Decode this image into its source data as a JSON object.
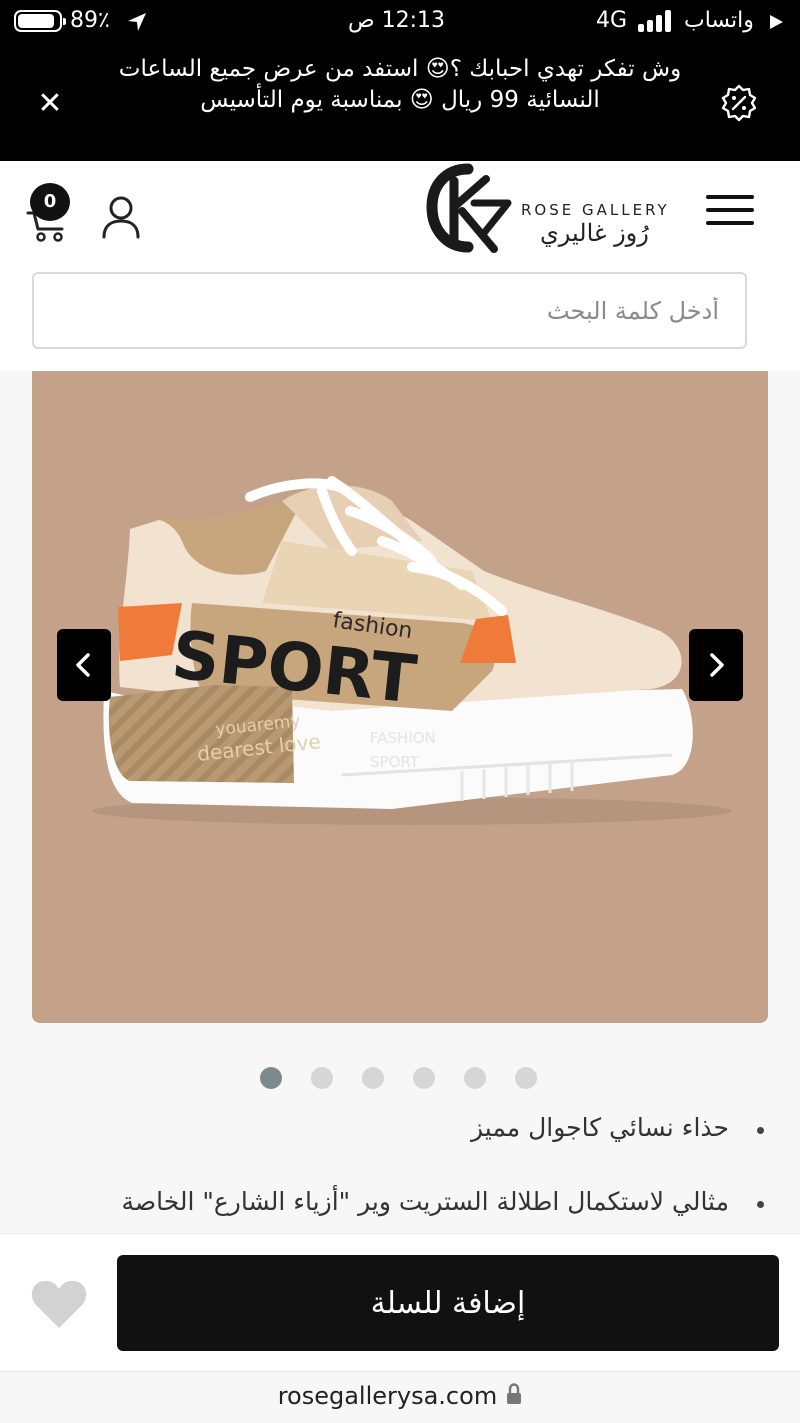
{
  "status_bar": {
    "battery": "89٪",
    "battery_level": 0.89,
    "time": "12:13 ص",
    "network": "4G",
    "back_app": "واتساب"
  },
  "promo": {
    "text": "وش تفكر تهدي احبابك ؟😍 استفد من عرض جميع الساعات النسائية 99 ريال 😍 بمناسبة يوم التأسيس",
    "close_icon": "close-icon",
    "badge_icon": "discount-badge-icon"
  },
  "header": {
    "cart_count": "0",
    "logo_en": "ROSE GALLERY",
    "logo_ar": "رُوز غاليري",
    "icons": [
      "cart-icon",
      "user-icon",
      "hamburger-menu-icon"
    ]
  },
  "search": {
    "placeholder": "أدخل كلمة البحث"
  },
  "product": {
    "image_text": {
      "brand_line": "fashion",
      "big_word": "SPORT",
      "heel_line_1": "youaremy",
      "heel_line_2": "dearest love",
      "sole_line_1": "FASHION",
      "sole_line_2": "SPORT"
    },
    "slides_total": 6,
    "slide_active": 1,
    "features": [
      "حذاء نسائي كاجوال مميز",
      "مثالي لاستكمال اطلالة الستريت وير \"أزياء الشارع\" الخاصة"
    ]
  },
  "actions": {
    "add_to_cart": "إضافة للسلة",
    "wishlist_icon": "heart-icon"
  },
  "browser": {
    "url": "rosegallerysa.com"
  },
  "colors": {
    "banner_bg": "#000000",
    "image_bg": "#c4a28a",
    "accent_orange": "#ef7a3a",
    "dot_active": "#7b8b8b",
    "dot_inactive": "#d6d6d6"
  }
}
